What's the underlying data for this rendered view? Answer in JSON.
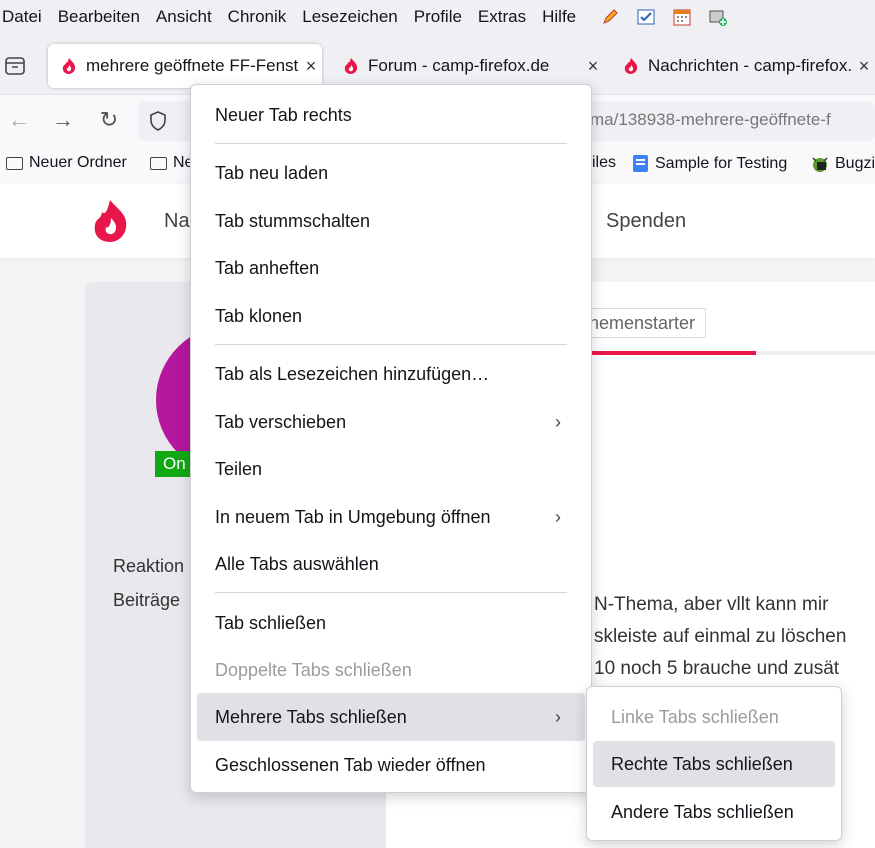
{
  "menubar": {
    "items": [
      "Datei",
      "Bearbeiten",
      "Ansicht",
      "Chronik",
      "Lesezeichen",
      "Profile",
      "Extras",
      "Hilfe"
    ],
    "icons": [
      "pencil-icon",
      "validator-icon",
      "calendar-icon",
      "screenshot-add-icon"
    ]
  },
  "tabs": [
    {
      "title": "mehrere geöffnete FF-Fenst",
      "close": "×"
    },
    {
      "title": "Forum - camp-firefox.de",
      "close": "×"
    },
    {
      "title": "Nachrichten - camp-firefox.",
      "close": "×"
    }
  ],
  "navbar": {
    "url_visible": "ma/138938-mehrere-geöffnete-f"
  },
  "bookmarks": {
    "items": [
      "Neuer Ordner",
      "Ne",
      "iles",
      "Sample for Testing",
      "Bugzi"
    ]
  },
  "site": {
    "nav_left": "Na",
    "nav_right": "Spenden",
    "online": "On",
    "reaktion": "Reaktion",
    "beitraege": "Beiträge",
    "badge": "hemenstarter",
    "post_lines": [
      "N-Thema, aber vllt kann mir",
      "skleiste auf einmal zu löschen",
      "10 noch 5 brauche und zusät"
    ]
  },
  "context_menu": {
    "items": [
      {
        "label": "Neuer Tab rechts"
      },
      {
        "label": "Tab neu laden"
      },
      {
        "label": "Tab stummschalten"
      },
      {
        "label": "Tab anheften"
      },
      {
        "label": "Tab klonen"
      },
      {
        "label": "Tab als Lesezeichen hinzufügen…"
      },
      {
        "label": "Tab verschieben"
      },
      {
        "label": "Teilen"
      },
      {
        "label": "In neuem Tab in Umgebung öffnen"
      },
      {
        "label": "Alle Tabs auswählen"
      },
      {
        "label": "Tab schließen"
      },
      {
        "label": "Doppelte Tabs schließen"
      },
      {
        "label": "Mehrere Tabs schließen"
      },
      {
        "label": "Geschlossenen Tab wieder öffnen"
      }
    ]
  },
  "submenu": {
    "items": [
      {
        "label": "Linke Tabs schließen"
      },
      {
        "label": "Rechte Tabs schließen"
      },
      {
        "label": "Andere Tabs schließen"
      }
    ]
  }
}
